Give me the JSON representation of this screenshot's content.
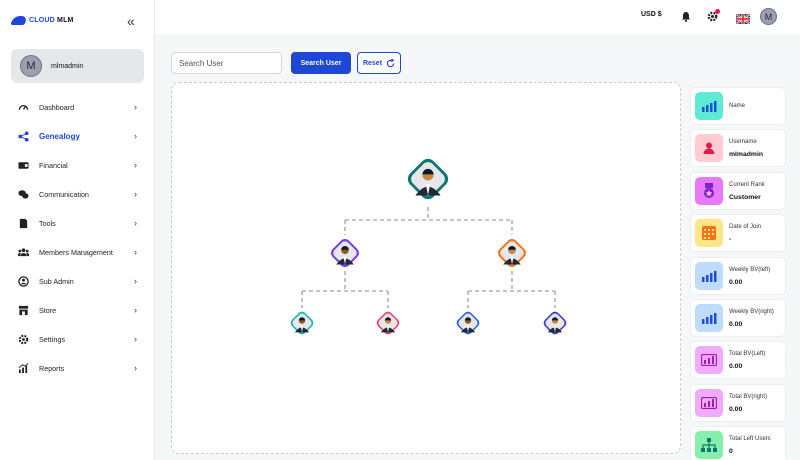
{
  "app": {
    "logo_text": "CLOUD",
    "logo_text_bold": "MLM"
  },
  "user": {
    "avatar_initial": "M",
    "name": "mlmadmin"
  },
  "sidebar": {
    "items": [
      {
        "label": "Dashboard",
        "icon": "dashboard-icon",
        "active": false
      },
      {
        "label": "Genealogy",
        "icon": "genealogy-icon",
        "active": true
      },
      {
        "label": "Financial",
        "icon": "wallet-icon",
        "active": false
      },
      {
        "label": "Communication",
        "icon": "chat-icon",
        "active": false
      },
      {
        "label": "Tools",
        "icon": "tools-icon",
        "active": false
      },
      {
        "label": "Members Management",
        "icon": "members-icon",
        "active": false
      },
      {
        "label": "Sub Admin",
        "icon": "sub-admin-icon",
        "active": false
      },
      {
        "label": "Store",
        "icon": "store-icon",
        "active": false
      },
      {
        "label": "Settings",
        "icon": "settings-icon",
        "active": false
      },
      {
        "label": "Reports",
        "icon": "reports-icon",
        "active": false
      }
    ]
  },
  "header": {
    "currency": "USD $",
    "avatar_initial": "M"
  },
  "toolbar": {
    "search_placeholder": "Search User",
    "search_label": "Search User",
    "reset_label": "Reset"
  },
  "tree": {
    "nodes": [
      {
        "level": 0,
        "border": "#0f766e"
      },
      {
        "level": 1,
        "border": "#7c3aed"
      },
      {
        "level": 1,
        "border": "#f97316"
      },
      {
        "level": 2,
        "border": "#14b8a6"
      },
      {
        "level": 2,
        "border": "#f43f5e"
      },
      {
        "level": 2,
        "border": "#2563eb"
      },
      {
        "level": 2,
        "border": "#4338ca"
      }
    ]
  },
  "info_cards": [
    {
      "label": "Name",
      "value": "",
      "icon": "chart-icon",
      "bg": "#5eead4",
      "fg": "#1d4ed8"
    },
    {
      "label": "Username",
      "value": "mlmadmin",
      "icon": "user-icon",
      "bg": "#fecdd3",
      "fg": "#e11d48"
    },
    {
      "label": "Current Rank",
      "value": "Customer",
      "icon": "rank-icon",
      "bg": "#e879f9",
      "fg": "#7e22ce"
    },
    {
      "label": "Date of Join",
      "value": "-",
      "icon": "calendar-icon",
      "bg": "#fde68a",
      "fg": "#f97316"
    },
    {
      "label": "Weekly BV(left)",
      "value": "0.00",
      "icon": "chart-icon",
      "bg": "#bfdbfe",
      "fg": "#1d4ed8"
    },
    {
      "label": "Weekly BV(right)",
      "value": "0.00",
      "icon": "chart-icon",
      "bg": "#bfdbfe",
      "fg": "#1d4ed8"
    },
    {
      "label": "Total BV(Left)",
      "value": "0.00",
      "icon": "bar-chart-icon",
      "bg": "#f0abfc",
      "fg": "#a21caf"
    },
    {
      "label": "Total BV(right)",
      "value": "0.00",
      "icon": "bar-chart-icon",
      "bg": "#f0abfc",
      "fg": "#a21caf"
    },
    {
      "label": "Total Left Users",
      "value": "0",
      "icon": "tree-icon",
      "bg": "#86efac",
      "fg": "#0f766e"
    }
  ]
}
